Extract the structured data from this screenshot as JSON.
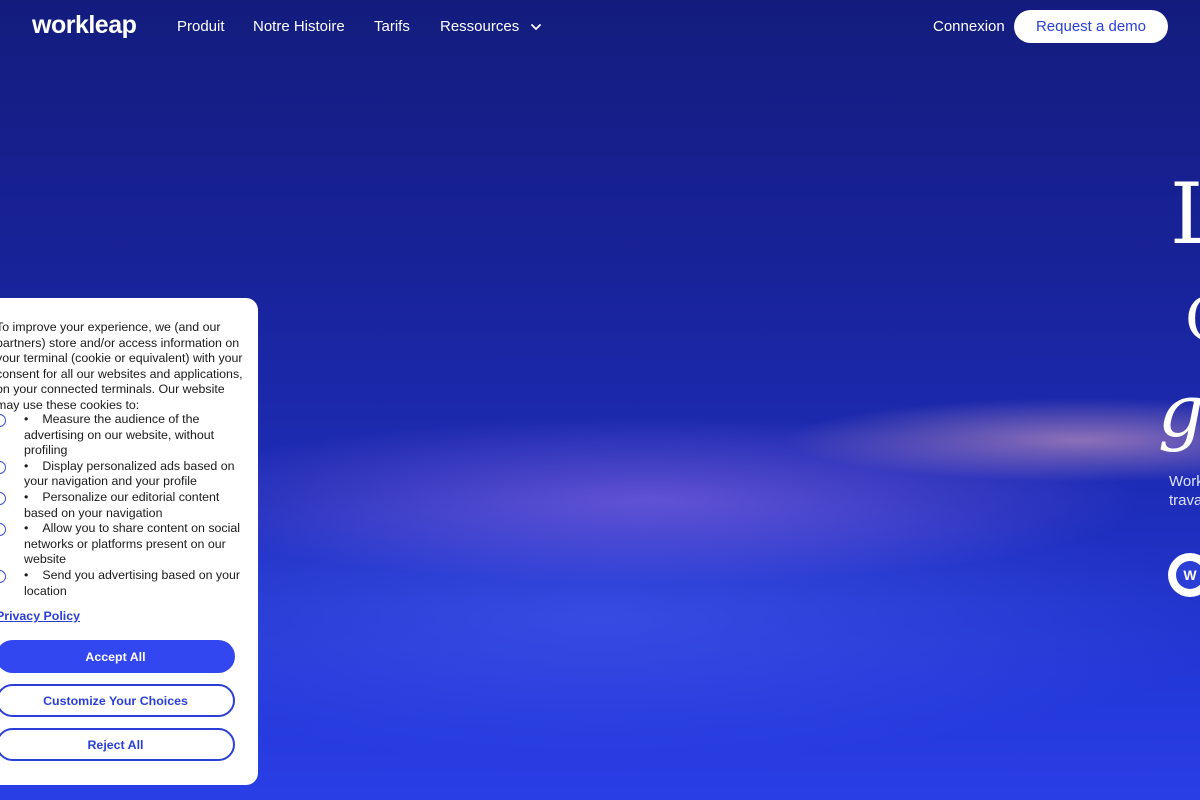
{
  "header": {
    "logo": "workleap",
    "nav": [
      "Produit",
      "Notre Histoire",
      "Tarifs",
      "Ressources"
    ],
    "login": "Connexion",
    "demo": "Request a demo"
  },
  "hero": {
    "title_fragments": [
      "L",
      "C",
      "g"
    ],
    "subtitle_lines": [
      "Work",
      "trava"
    ],
    "badge_letter": "W"
  },
  "cookie": {
    "intro": "To improve your experience, we (and our partners) store and/or access information on your terminal (cookie or equivalent) with your consent for all our websites and applications, on your connected terminals. Our website may use these cookies to:",
    "items": [
      "Measure the audience of the advertising on our website, without profiling",
      "Display personalized ads based on your navigation and your profile",
      "Personalize our editorial content based on your navigation",
      "Allow you to share content on social networks or platforms present on our website",
      "Send you advertising based on your location"
    ],
    "privacy": "Privacy Policy",
    "accept": "Accept All",
    "customize": "Customize Your Choices",
    "reject": "Reject All"
  },
  "colors": {
    "accent": "#3347f0",
    "hero_bg": "#16208a"
  }
}
